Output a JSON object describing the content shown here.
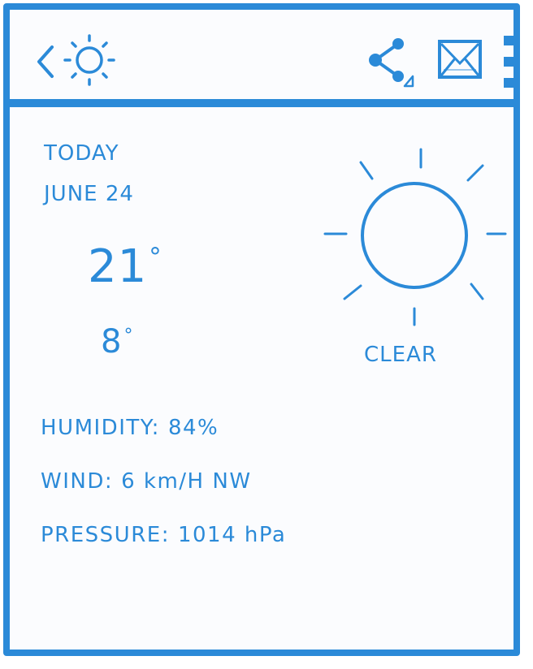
{
  "toolbar": {
    "icons": [
      "back-arrow-icon",
      "sun-icon",
      "share-icon",
      "mail-icon",
      "more-vert-icon"
    ]
  },
  "forecast": {
    "day": "TODAY",
    "date": "JUNE 24",
    "high": "21",
    "low": "8",
    "degree_symbol": "°",
    "condition": "CLEAR",
    "condition_icon": "sun-icon"
  },
  "details": {
    "humidity": {
      "label": "HUMIDITY:",
      "value": "84%"
    },
    "wind": {
      "label": "WIND:",
      "value": "6 km/H NW"
    },
    "pressure": {
      "label": "PRESSURE:",
      "value": "1014 hPa"
    }
  },
  "colors": {
    "accent": "#2b8ad8",
    "background": "#fbfcfe"
  }
}
